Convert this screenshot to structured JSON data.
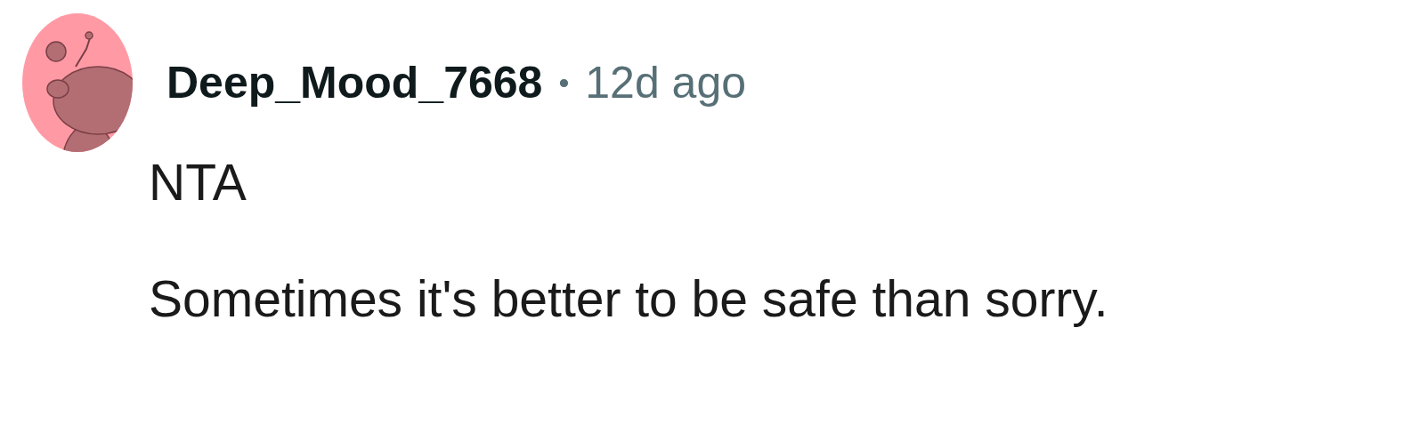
{
  "comment": {
    "author": "Deep_Mood_7668",
    "separator": "•",
    "time": "12d ago",
    "paragraphs": [
      "NTA",
      "Sometimes it's better to be safe than sorry."
    ]
  }
}
